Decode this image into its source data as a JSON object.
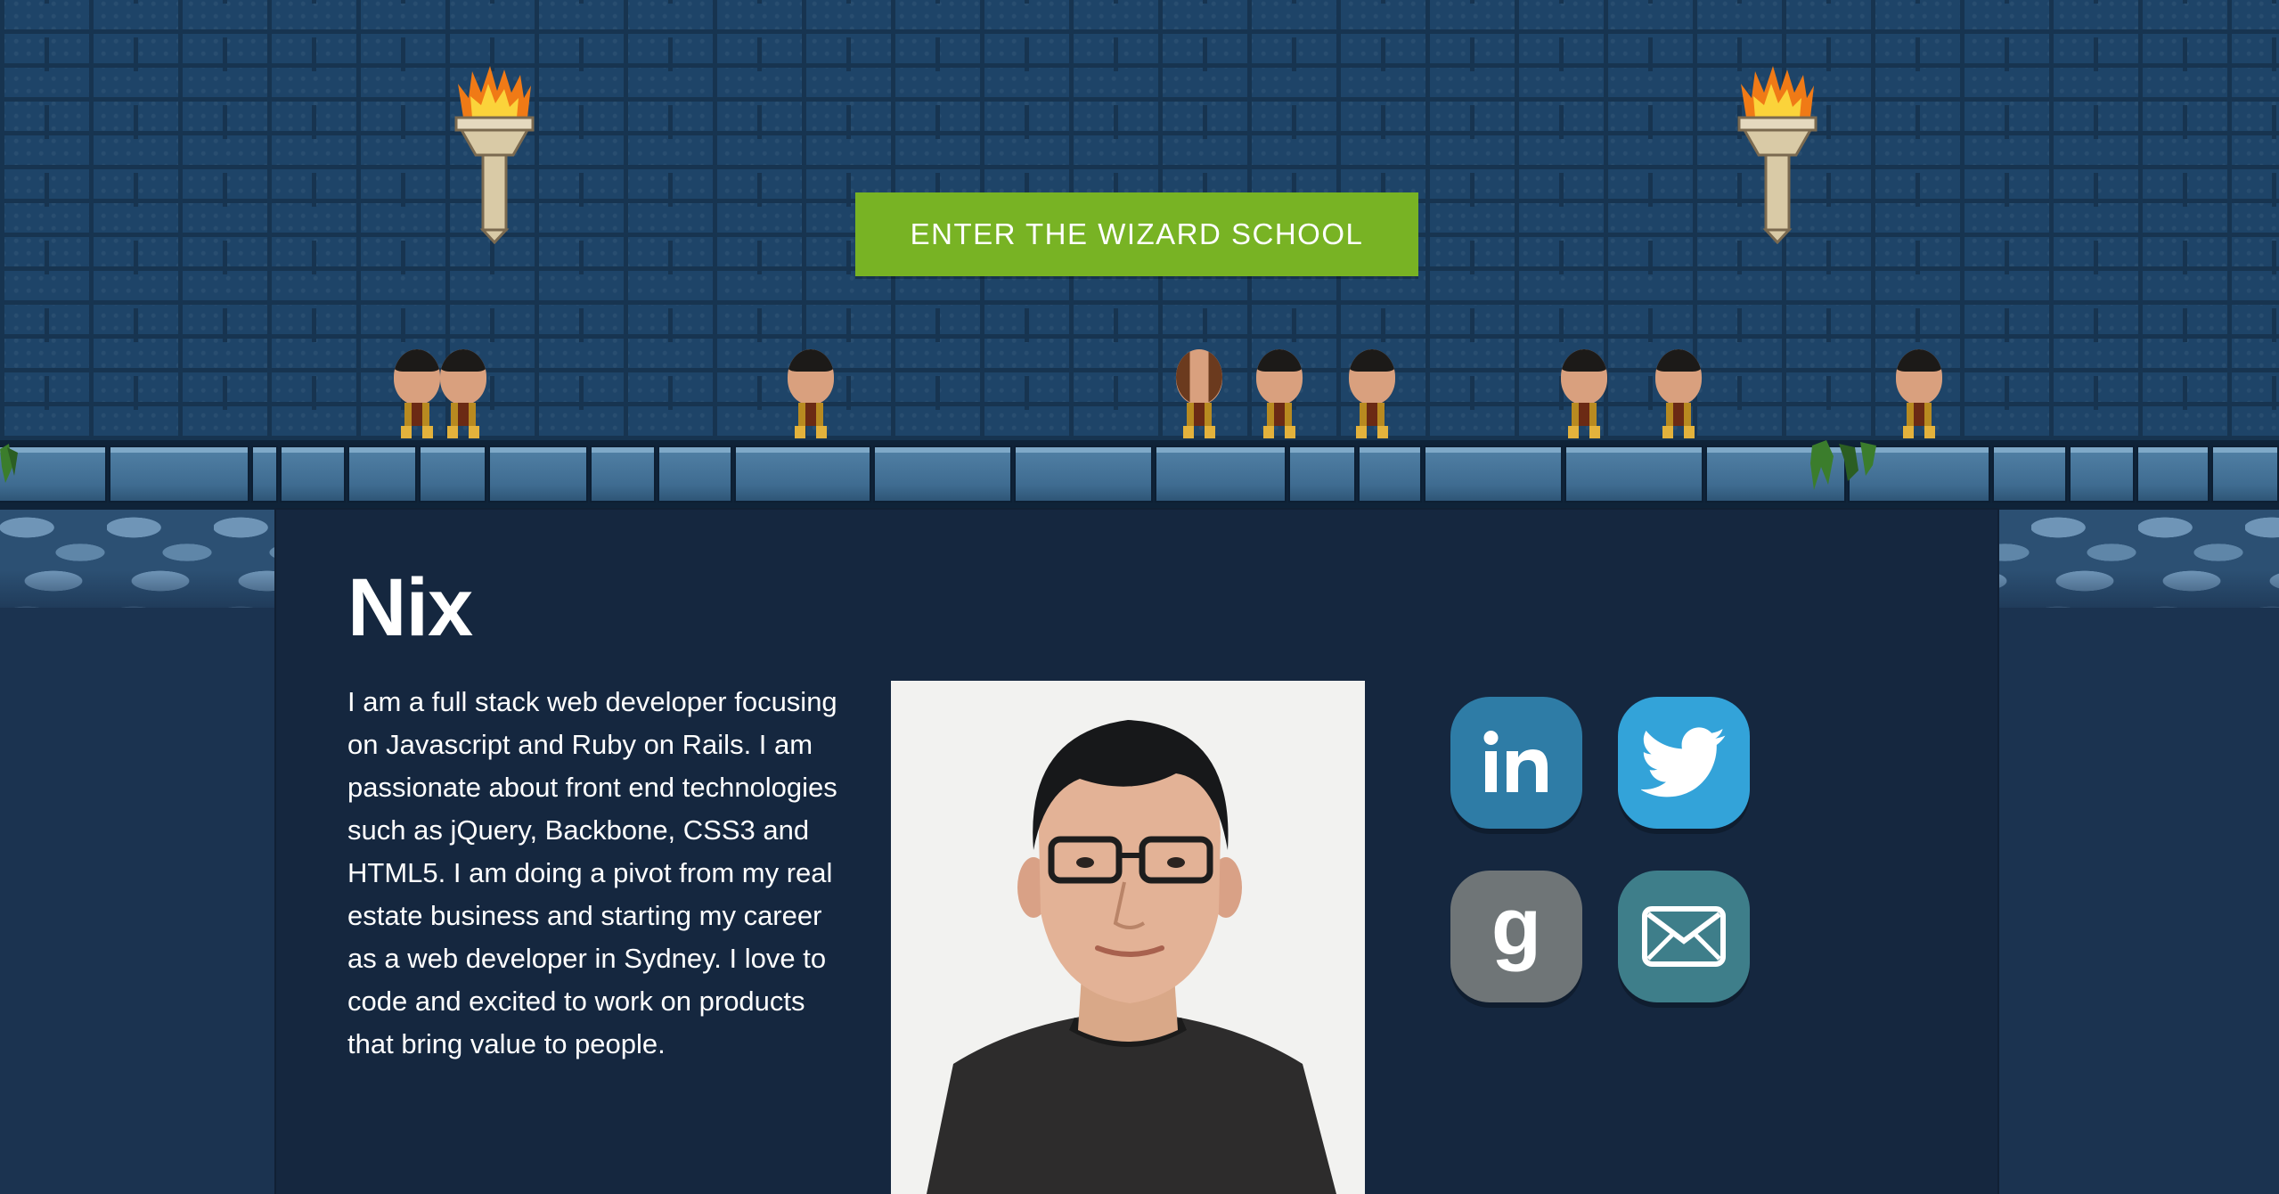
{
  "hero": {
    "enter_button_label": "ENTER THE WIZARD SCHOOL"
  },
  "profile": {
    "name": "Nix",
    "bio": "I am a full stack web developer focusing on Javascript and Ruby on Rails. I am passionate about front end technologies such as jQuery, Backbone, CSS3 and HTML5. I am doing a pivot from my real estate business and starting my career as a web developer in Sydney. I love to code and excited to work on products that bring value to people."
  },
  "social": [
    {
      "name": "linkedin",
      "icon": "linkedin-icon",
      "color": "#2e7ca6"
    },
    {
      "name": "twitter",
      "icon": "twitter-bird-icon",
      "color": "#33a3d9"
    },
    {
      "name": "goodreads",
      "icon": "goodreads-g-icon",
      "color": "#6f7577"
    },
    {
      "name": "email",
      "icon": "envelope-icon",
      "color": "#3e7e8a"
    }
  ],
  "colors": {
    "accent_green": "#78b324",
    "panel_background": "#15273f",
    "wall_blue": "#1e4468"
  }
}
